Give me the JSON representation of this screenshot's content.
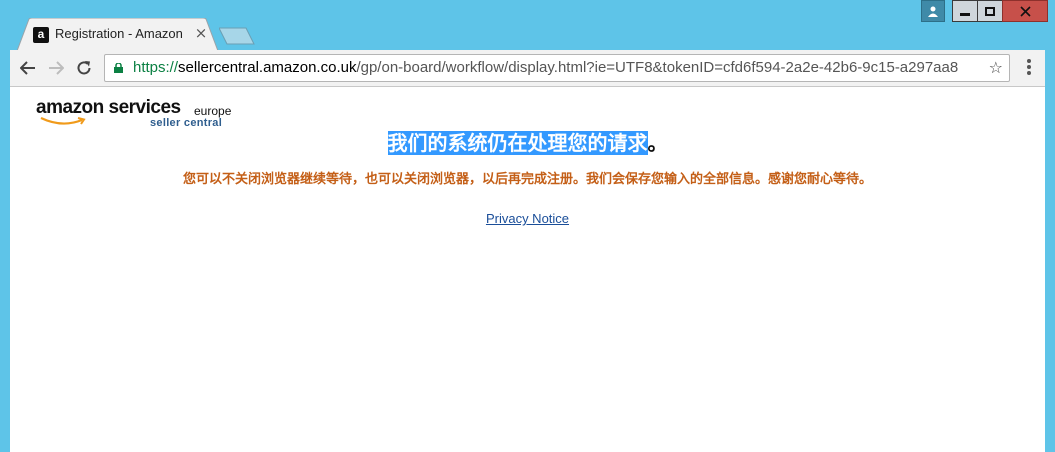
{
  "browser": {
    "tab_title": "Registration - Amazon",
    "tab_close_glyph": "×",
    "url_scheme": "https://",
    "url_host": "sellercentral.amazon.co.uk",
    "url_path": "/gp/on-board/workflow/display.html?ie=UTF8&tokenID=cfd6f594-2a2e-42b6-9c15-a297aa8",
    "favicon_letter": "a",
    "star_glyph": "☆"
  },
  "logo": {
    "brand": "amazon services",
    "region": "europe",
    "product": "seller central"
  },
  "main": {
    "heading": "我们的系统仍在处理您的请求",
    "heading_suffix": "。",
    "message": "您可以不关闭浏览器继续等待，也可以关闭浏览器，以后再完成注册。我们会保存您输入的全部信息。感谢您耐心等待。",
    "privacy_link": "Privacy Notice"
  },
  "colors": {
    "window_frame": "#5ec4e8",
    "message_text": "#c45f17",
    "highlight": "#3399ff",
    "link": "#1a4e99"
  }
}
